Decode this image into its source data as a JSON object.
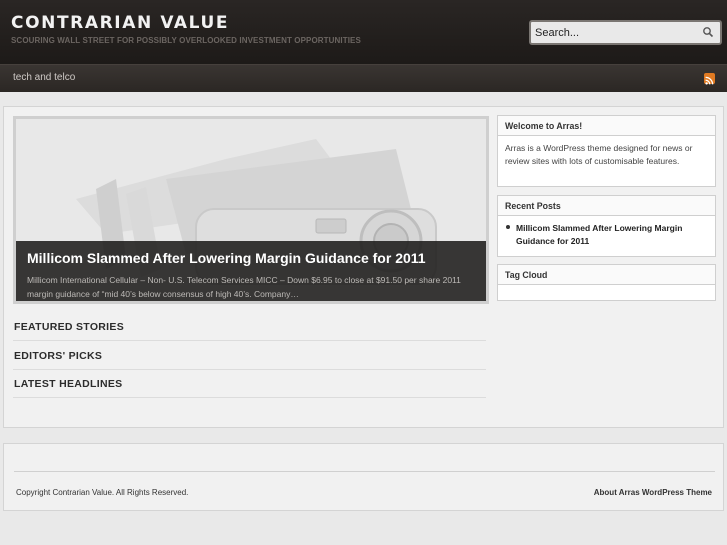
{
  "header": {
    "site_title": "CONTRARIAN VALUE",
    "site_description": "SCOURING WALL STREET FOR POSSIBLY OVERLOOKED INVESTMENT OPPORTUNITIES",
    "search_placeholder": "Search...",
    "search_icon": "magnifier-icon"
  },
  "nav": {
    "items": [
      {
        "label": "tech and telco"
      }
    ],
    "rss_icon": "rss-feed-icon",
    "rss_color": "#e07a22"
  },
  "featured": {
    "title": "Millicom Slammed After Lowering Margin Guidance for 2011",
    "excerpt": "Millicom International Cellular – Non- U.S. Telecom Services MICC – Down $6.95 to close at $91.50 per share 2011 margin guidance of “mid 40’s below consensus of high 40’s. Company…"
  },
  "sections": [
    {
      "label": "FEATURED STORIES"
    },
    {
      "label": "EDITORS' PICKS"
    },
    {
      "label": "LATEST HEADLINES"
    }
  ],
  "sidebar": {
    "welcome": {
      "title": "Welcome to Arras!",
      "body": "Arras is a WordPress theme designed for news or review sites with lots of customisable features."
    },
    "recent_posts": {
      "title": "Recent Posts",
      "items": [
        {
          "label": "Millicom Slammed After Lowering Margin Guidance for 2011"
        }
      ]
    },
    "tag_cloud": {
      "title": "Tag Cloud"
    }
  },
  "footer": {
    "copyright": "Copyright Contrarian Value. All Rights Reserved.",
    "about_link": "About Arras WordPress Theme"
  }
}
